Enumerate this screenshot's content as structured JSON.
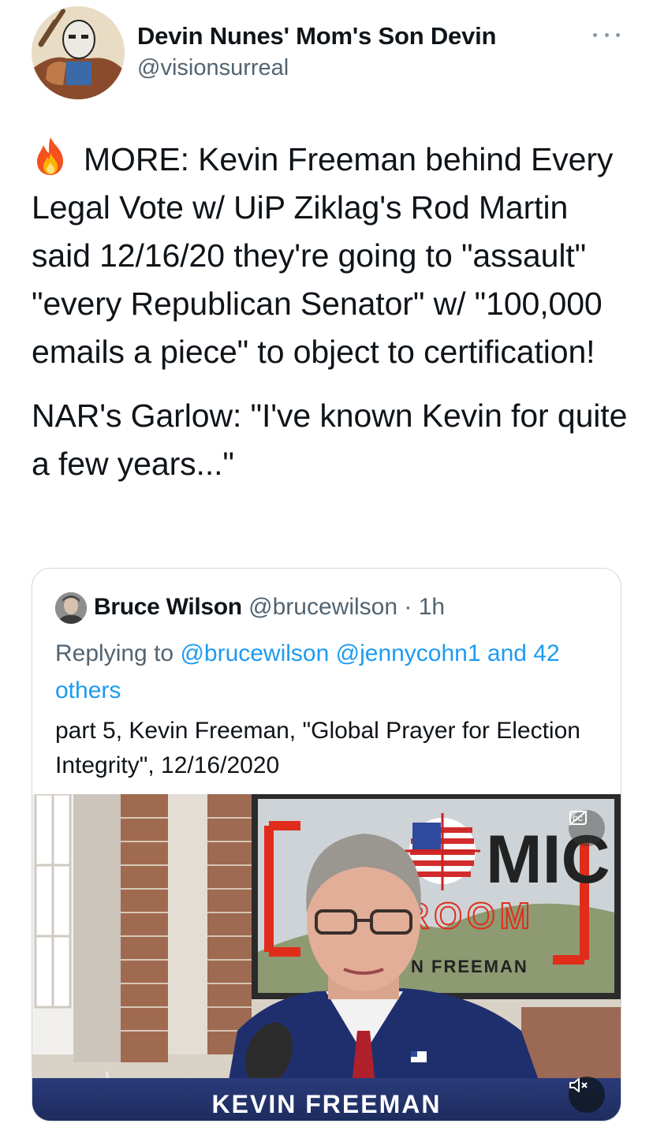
{
  "tweet": {
    "author_name": "Devin Nunes' Mom's Son Devin",
    "author_handle": "@visionsurreal",
    "text_p1": "MORE: Kevin Freeman behind Every Legal Vote w/ UiP Ziklag's Rod Martin said 12/16/20 they're going to \"assault\" \"every Republican Senator\" w/ \"100,000 emails a piece\" to object to certification!",
    "text_p2": "NAR's Garlow: \"I've known Kevin for quite a few years...\"",
    "emoji_icon": "fire-icon"
  },
  "quoted": {
    "author_name": "Bruce Wilson",
    "author_handle": "@brucewilson",
    "time": " · 1h",
    "replying_prefix": "Replying to ",
    "replying_mentions": "@brucewilson @jennycohn1 and 42 others",
    "text": "part 5, Kevin Freeman, \"Global Prayer for Election Integrity\", 12/16/2020",
    "video": {
      "lower_third": "KEVIN FREEMAN",
      "backdrop_top": "MIC",
      "backdrop_room": "ROOM",
      "backdrop_name": "N FREEMAN",
      "cc_icon": "closed-captions-icon",
      "mute_icon": "speaker-muted-icon"
    }
  },
  "colors": {
    "text": "#0f1419",
    "secondary": "#536471",
    "link": "#1d9bf0",
    "border": "#cfd9de"
  }
}
